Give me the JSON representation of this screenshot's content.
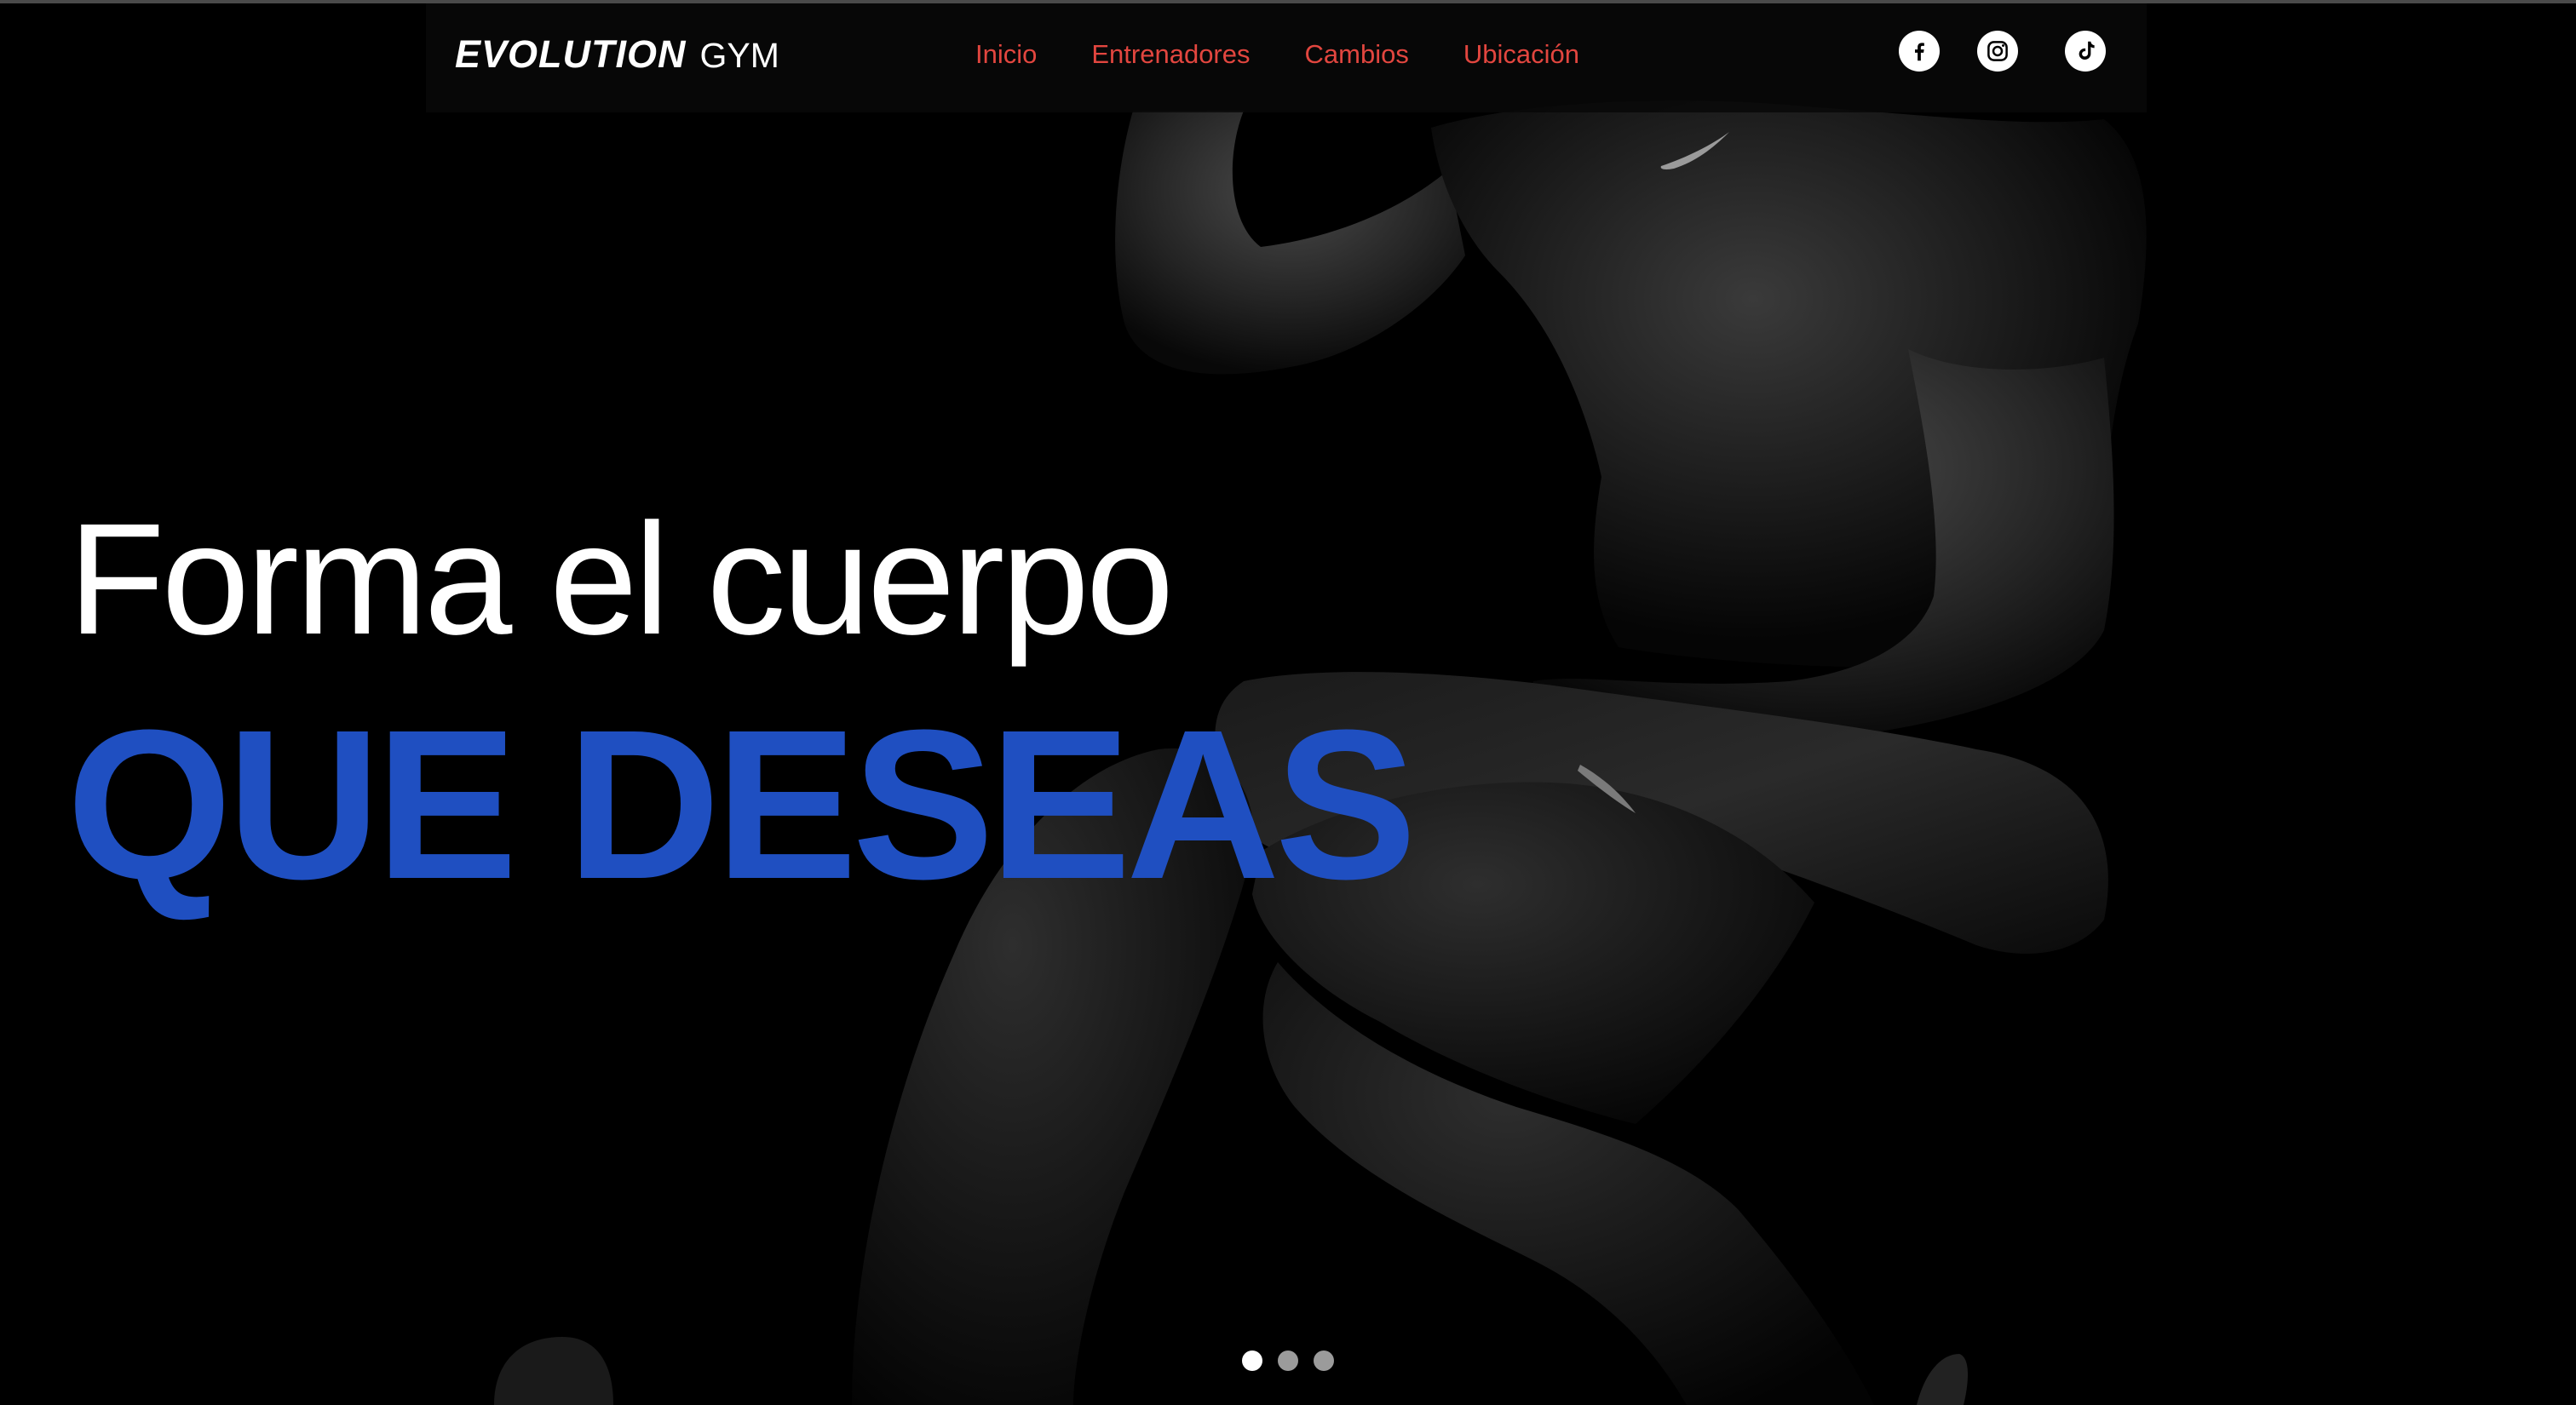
{
  "brand": {
    "name_bold": "EVOLUTION",
    "name_light": "GYM"
  },
  "nav": {
    "items": [
      {
        "label": "Inicio"
      },
      {
        "label": "Entrenadores"
      },
      {
        "label": "Cambios"
      },
      {
        "label": "Ubicación"
      }
    ],
    "link_color": "#e2463f"
  },
  "social": [
    {
      "icon": "facebook-icon"
    },
    {
      "icon": "instagram-icon"
    },
    {
      "icon": "tiktok-icon"
    }
  ],
  "hero": {
    "line1": "Forma el cuerpo",
    "line2": "QUE DESEAS",
    "accent_color": "#1f4fc1",
    "slides": 3,
    "active_slide": 1
  }
}
